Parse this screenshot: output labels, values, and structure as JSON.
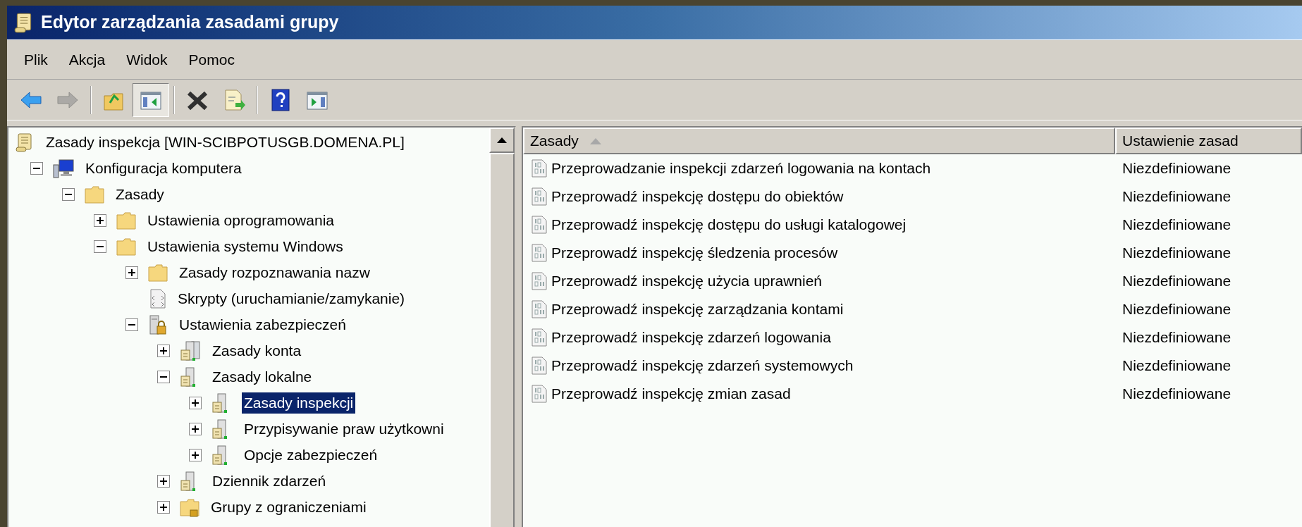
{
  "window": {
    "title": "Edytor zarządzania zasadami grupy"
  },
  "menu": [
    {
      "label": "Plik"
    },
    {
      "label": "Akcja"
    },
    {
      "label": "Widok"
    },
    {
      "label": "Pomoc"
    }
  ],
  "toolbar": [
    {
      "kind": "back",
      "disabled": false,
      "pressed": false
    },
    {
      "kind": "forward",
      "disabled": true,
      "pressed": false
    },
    {
      "kind": "separator"
    },
    {
      "kind": "up",
      "disabled": false,
      "pressed": false
    },
    {
      "kind": "tree-toggle",
      "disabled": false,
      "pressed": true
    },
    {
      "kind": "separator"
    },
    {
      "kind": "delete",
      "disabled": false,
      "pressed": false
    },
    {
      "kind": "export",
      "disabled": false,
      "pressed": false
    },
    {
      "kind": "separator"
    },
    {
      "kind": "help",
      "disabled": false,
      "pressed": false
    },
    {
      "kind": "action-pane",
      "disabled": false,
      "pressed": false
    }
  ],
  "tree": [
    {
      "label": "Zasady inspekcja [WIN-SCIBPOTUSGB.DOMENA.PL]",
      "kind": "scroll",
      "selected": false,
      "children": [
        {
          "label": "Konfiguracja komputera",
          "kind": "computer",
          "expanded": true,
          "selected": false,
          "children": [
            {
              "label": "Zasady",
              "kind": "folder",
              "expanded": true,
              "selected": false,
              "children": [
                {
                  "label": "Ustawienia oprogramowania",
                  "kind": "folder",
                  "expanded": false,
                  "selected": false
                },
                {
                  "label": "Ustawienia systemu Windows",
                  "kind": "folder",
                  "expanded": true,
                  "selected": false,
                  "children": [
                    {
                      "label": "Zasady rozpoznawania nazw",
                      "kind": "folder",
                      "expanded": false,
                      "selected": false
                    },
                    {
                      "label": "Skrypty (uruchamianie/zamykanie)",
                      "kind": "script",
                      "selected": false
                    },
                    {
                      "label": "Ustawienia zabezpieczeń",
                      "kind": "security",
                      "expanded": true,
                      "selected": false,
                      "children": [
                        {
                          "label": "Zasady konta",
                          "kind": "servers",
                          "expanded": false,
                          "selected": false
                        },
                        {
                          "label": "Zasady lokalne",
                          "kind": "server",
                          "expanded": true,
                          "selected": false,
                          "children": [
                            {
                              "label": "Zasady inspekcji",
                              "kind": "server",
                              "expanded": false,
                              "selected": true
                            },
                            {
                              "label": "Przypisywanie praw użytkowni",
                              "kind": "server",
                              "expanded": false,
                              "selected": false
                            },
                            {
                              "label": "Opcje zabezpieczeń",
                              "kind": "server",
                              "expanded": false,
                              "selected": false
                            }
                          ]
                        },
                        {
                          "label": "Dziennik zdarzeń",
                          "kind": "server",
                          "expanded": false,
                          "selected": false
                        },
                        {
                          "label": "Grupy z ograniczeniami",
                          "kind": "folder-lock",
                          "expanded": false,
                          "selected": false
                        }
                      ]
                    }
                  ]
                }
              ]
            }
          ]
        }
      ]
    }
  ],
  "table": {
    "columns": [
      {
        "label": "Zasady",
        "sorted": true
      },
      {
        "label": "Ustawienie zasad",
        "sorted": false
      }
    ],
    "rows": [
      {
        "policy": "Przeprowadzanie inspekcji zdarzeń logowania na kontach",
        "setting": "Niezdefiniowane"
      },
      {
        "policy": "Przeprowadź inspekcję dostępu do obiektów",
        "setting": "Niezdefiniowane"
      },
      {
        "policy": "Przeprowadź inspekcję dostępu do usługi katalogowej",
        "setting": "Niezdefiniowane"
      },
      {
        "policy": "Przeprowadź inspekcję śledzenia procesów",
        "setting": "Niezdefiniowane"
      },
      {
        "policy": "Przeprowadź inspekcję użycia uprawnień",
        "setting": "Niezdefiniowane"
      },
      {
        "policy": "Przeprowadź inspekcję zarządzania kontami",
        "setting": "Niezdefiniowane"
      },
      {
        "policy": "Przeprowadź inspekcję zdarzeń logowania",
        "setting": "Niezdefiniowane"
      },
      {
        "policy": "Przeprowadź inspekcję zdarzeń systemowych",
        "setting": "Niezdefiniowane"
      },
      {
        "policy": "Przeprowadź inspekcję zmian zasad",
        "setting": "Niezdefiniowane"
      }
    ]
  }
}
